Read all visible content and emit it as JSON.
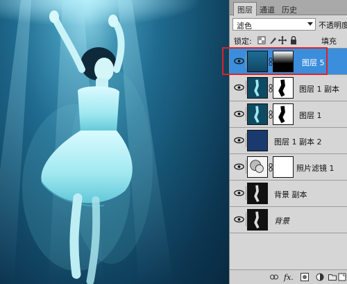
{
  "panel": {
    "tabs": [
      "图层",
      "通道",
      "历史"
    ],
    "blend_mode": "滤色",
    "opacity_label": "不透明度",
    "lock_label": "锁定:",
    "fill_label": "填充",
    "layers": [
      {
        "name": "图层 5",
        "selected": true
      },
      {
        "name": "图层 1 副本",
        "selected": false
      },
      {
        "name": "图层 1",
        "selected": false
      },
      {
        "name": "图层 1 副本 2",
        "selected": false
      },
      {
        "name": "照片滤镜 1",
        "selected": false
      },
      {
        "name": "背景 副本",
        "selected": false
      },
      {
        "name": "背景",
        "selected": false
      }
    ],
    "bottom_fx": "fx."
  },
  "colors": {
    "selected_row": "#3b8edb",
    "highlight_box": "#e0202a",
    "water_dark": "#0c3550",
    "water_light": "#8fd4e6"
  }
}
